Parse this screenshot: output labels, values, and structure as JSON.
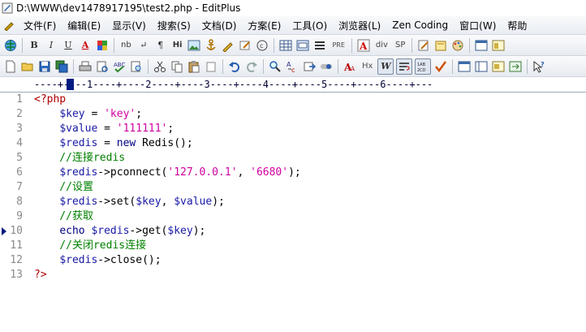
{
  "window": {
    "title": "D:\\WWW\\dev1478917195\\test2.php - EditPlus"
  },
  "menu": [
    "文件(F)",
    "编辑(E)",
    "显示(V)",
    "搜索(S)",
    "文档(D)",
    "方案(E)",
    "工具(O)",
    "浏览器(L)",
    "Zen Coding",
    "窗口(W)",
    "帮助"
  ],
  "ruler": {
    "text": "----+----1----+----2----+----3----+----4----+----5----+----6----+---"
  },
  "code": {
    "lines": [
      {
        "num": "1",
        "text": "<?php"
      },
      {
        "num": "2",
        "text": "    $key = 'key';"
      },
      {
        "num": "3",
        "text": "    $value = '111111';"
      },
      {
        "num": "4",
        "text": "    $redis = new Redis();"
      },
      {
        "num": "5",
        "text": "    //连接redis"
      },
      {
        "num": "6",
        "text": "    $redis->pconnect('127.0.0.1', '6680');"
      },
      {
        "num": "7",
        "text": "    //设置"
      },
      {
        "num": "8",
        "text": "    $redis->set($key, $value);"
      },
      {
        "num": "9",
        "text": "    //获取"
      },
      {
        "num": "10",
        "text": "    echo $redis->get($key);"
      },
      {
        "num": "11",
        "text": "    //关闭redis连接"
      },
      {
        "num": "12",
        "text": "    $redis->close();"
      },
      {
        "num": "13",
        "text": "?>"
      }
    ],
    "active_line": "10"
  },
  "toolbar1": [
    "globe-icon",
    "B",
    "I",
    "U",
    "A",
    "palette-icon",
    "nb",
    "↵",
    "¶",
    "Hi",
    "image-icon",
    "anchor-icon",
    "pencil-icon",
    "pen-icon",
    "copyright-icon",
    "table-icon",
    "grid-icon",
    "list-icon",
    "PRE",
    "A-icon",
    "div",
    "SP",
    "edit-icon",
    "open-icon",
    "palette2-icon",
    "panel-icon",
    "panel2-icon"
  ],
  "toolbar2": [
    "new-icon",
    "open-icon",
    "save-icon",
    "saveall-icon",
    "print-icon",
    "preview-icon",
    "spell-icon",
    "find-icon",
    "cut-icon",
    "copy-icon",
    "paste-icon",
    "delete-icon",
    "undo-icon",
    "redo-icon",
    "search-icon",
    "replace-icon",
    "goto-icon",
    "toggle-icon",
    "font-icon",
    "Hx",
    "W",
    "wrap-icon",
    "column-icon",
    "check-icon",
    "win1-icon",
    "win2-icon",
    "win3-icon",
    "win4-icon",
    "help-icon"
  ]
}
